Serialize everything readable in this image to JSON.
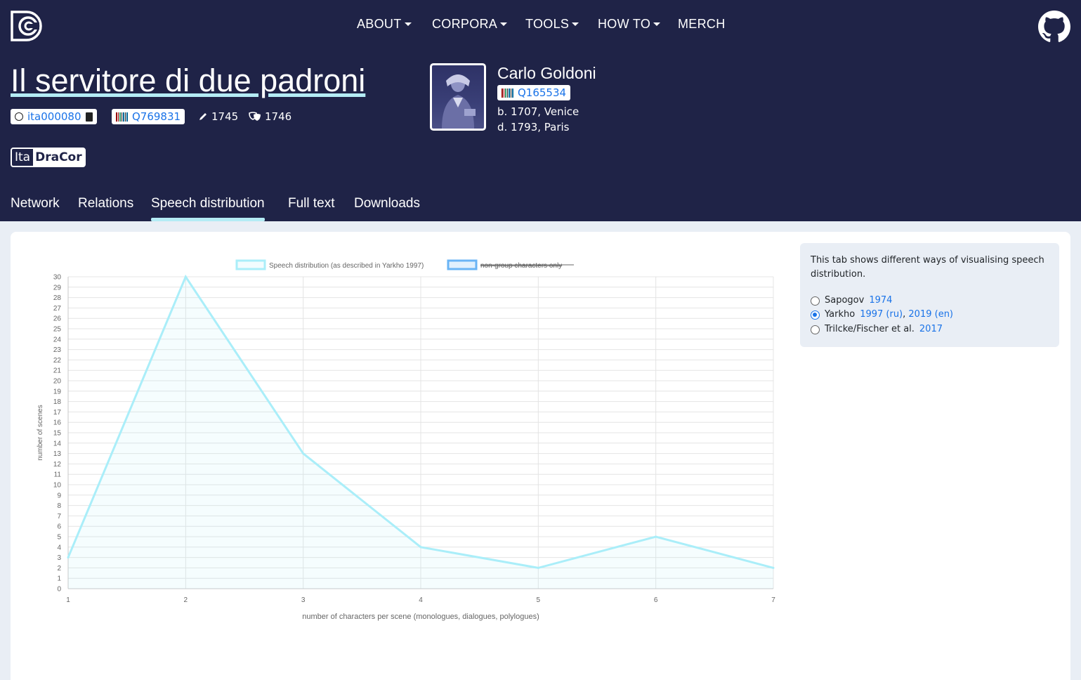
{
  "nav": {
    "items": [
      {
        "label": "ABOUT",
        "dropdown": true
      },
      {
        "label": "CORPORA",
        "dropdown": true
      },
      {
        "label": "TOOLS",
        "dropdown": true
      },
      {
        "label": "HOW TO",
        "dropdown": true
      },
      {
        "label": "MERCH",
        "dropdown": false
      }
    ],
    "logo_icon": "dracor-logo-icon",
    "github_icon": "github-icon"
  },
  "play": {
    "title": "Il servitore di due padroni",
    "id": "ita000080",
    "wikidata": "Q769831",
    "written_year": "1745",
    "premiere_year": "1746",
    "corpus_prefix": "Ita",
    "corpus_name": "DraCor"
  },
  "author": {
    "name": "Carlo Goldoni",
    "wikidata": "Q165534",
    "birth": "b. 1707, Venice",
    "death": "d. 1793, Paris"
  },
  "tabs": [
    {
      "label": "Network",
      "active": false
    },
    {
      "label": "Relations",
      "active": false
    },
    {
      "label": "Speech distribution",
      "active": true
    },
    {
      "label": "Full text",
      "active": false
    },
    {
      "label": "Downloads",
      "active": false
    }
  ],
  "info": {
    "description": "This tab shows different ways of visualising speech distribution.",
    "options": [
      {
        "name": "Sapogov",
        "links": [
          "1974"
        ],
        "selected": false
      },
      {
        "name": "Yarkho",
        "links": [
          "1997 (ru)",
          "2019 (en)"
        ],
        "selected": true
      },
      {
        "name": "Trilcke/Fischer et al.",
        "links": [
          "2017"
        ],
        "selected": false
      }
    ]
  },
  "colors": {
    "header_bg": "#1f2347",
    "accent": "#b4ecf5",
    "link": "#1a73e8",
    "series_primary": "#aaeef9",
    "series_secondary": "#6ab4f5"
  },
  "chart_data": {
    "type": "area",
    "x": [
      1,
      2,
      3,
      4,
      5,
      6,
      7
    ],
    "series": [
      {
        "name": "Speech distribution (as described in Yarkho 1997)",
        "values": [
          3,
          30,
          13,
          4,
          2,
          5,
          2
        ],
        "hidden": false
      },
      {
        "name": "non-group characters only",
        "values": [],
        "hidden": true
      }
    ],
    "xlabel": "number of characters per scene (monologues, dialogues, polylogues)",
    "ylabel": "number of scenes",
    "xlim": [
      1,
      7
    ],
    "ylim": [
      0,
      30
    ],
    "y_ticks": [
      0,
      1,
      2,
      3,
      4,
      5,
      6,
      7,
      8,
      9,
      10,
      11,
      12,
      13,
      14,
      15,
      16,
      17,
      18,
      19,
      20,
      21,
      22,
      23,
      24,
      25,
      26,
      27,
      28,
      29,
      30
    ],
    "x_ticks": [
      1,
      2,
      3,
      4,
      5,
      6,
      7
    ],
    "grid": true,
    "legend_position": "top"
  }
}
